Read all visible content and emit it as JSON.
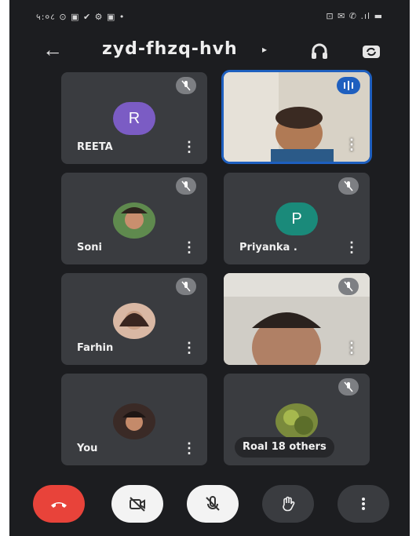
{
  "status_bar": {
    "left": "५:०८ ⊙ ▣ ✔ ⚙ ▣ •",
    "right": "⊡ ✉ ✆ .ıl ▬"
  },
  "header": {
    "meeting_code": "zyd-fhzq-hvh"
  },
  "participants": [
    {
      "name": "REETA",
      "avatar_letter": "R",
      "avatar_color": "#7b5cc4",
      "type": "letter",
      "muted": true
    },
    {
      "name": "",
      "type": "video",
      "speaking": true
    },
    {
      "name": "Soni",
      "type": "photo",
      "muted": true
    },
    {
      "name": "Priyanka .",
      "avatar_letter": "P",
      "avatar_color": "#1a8a7a",
      "type": "letter",
      "muted": true
    },
    {
      "name": "Farhin",
      "type": "photo",
      "muted": true
    },
    {
      "name": "",
      "type": "video",
      "muted": true
    },
    {
      "name": "You",
      "type": "photo",
      "muted": true
    },
    {
      "name": "Roal  18 others",
      "type": "photo",
      "muted": true
    }
  ],
  "colors": {
    "end_call": "#e8433a",
    "active_border": "#1e5fbf",
    "tile_bg": "#3a3c40"
  }
}
